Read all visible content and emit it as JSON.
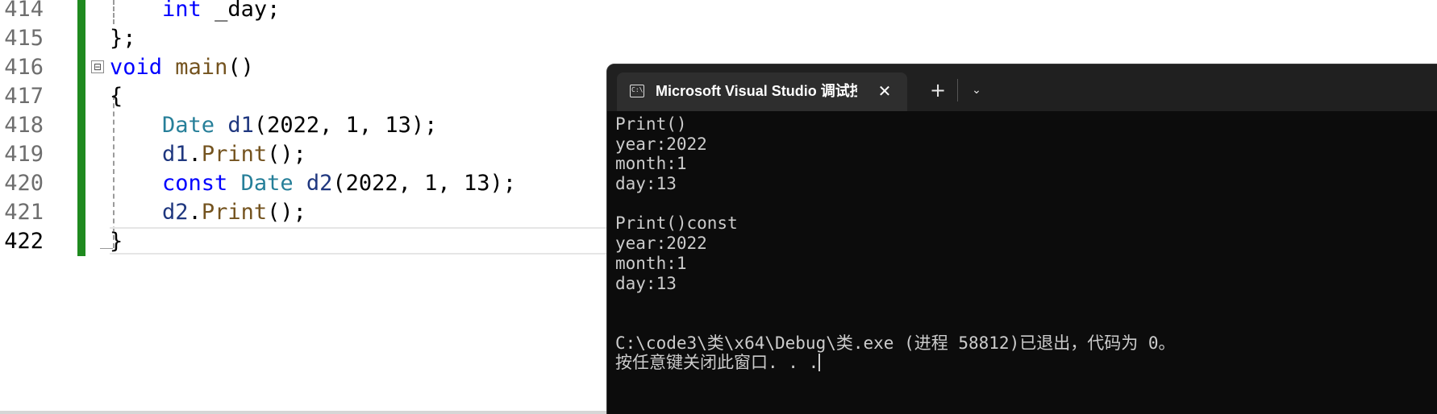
{
  "editor": {
    "lines": [
      {
        "number": "414",
        "tokens": [
          [
            "plain",
            "    "
          ],
          [
            "kw",
            "int"
          ],
          [
            "plain",
            " _day;"
          ]
        ]
      },
      {
        "number": "415",
        "tokens": [
          [
            "plain",
            "};"
          ]
        ]
      },
      {
        "number": "416",
        "tokens": [
          [
            "kw",
            "void"
          ],
          [
            "plain",
            " "
          ],
          [
            "fn",
            "main"
          ],
          [
            "plain",
            "()"
          ]
        ]
      },
      {
        "number": "417",
        "tokens": [
          [
            "plain",
            "{"
          ]
        ]
      },
      {
        "number": "418",
        "tokens": [
          [
            "plain",
            "    "
          ],
          [
            "ty2",
            "Date"
          ],
          [
            "plain",
            " "
          ],
          [
            "var",
            "d1"
          ],
          [
            "plain",
            "(2022, 1, 13);"
          ]
        ]
      },
      {
        "number": "419",
        "tokens": [
          [
            "plain",
            "    "
          ],
          [
            "var",
            "d1"
          ],
          [
            "plain",
            "."
          ],
          [
            "fn",
            "Print"
          ],
          [
            "plain",
            "();"
          ]
        ]
      },
      {
        "number": "420",
        "tokens": [
          [
            "plain",
            "    "
          ],
          [
            "kw",
            "const"
          ],
          [
            "plain",
            " "
          ],
          [
            "ty2",
            "Date"
          ],
          [
            "plain",
            " "
          ],
          [
            "var",
            "d2"
          ],
          [
            "plain",
            "(2022, 1, 13);"
          ]
        ]
      },
      {
        "number": "421",
        "tokens": [
          [
            "plain",
            "    "
          ],
          [
            "var",
            "d2"
          ],
          [
            "plain",
            "."
          ],
          [
            "fn",
            "Print"
          ],
          [
            "plain",
            "();"
          ]
        ]
      },
      {
        "number": "422",
        "tokens": [
          [
            "plain",
            "}"
          ]
        ],
        "current": true
      }
    ],
    "fold_symbol": "⊟"
  },
  "terminal": {
    "tab_title": "Microsoft Visual Studio 调试控制台",
    "tab_icon": "C:\\",
    "close_glyph": "✕",
    "new_tab_glyph": "+",
    "dropdown_glyph": "⌄",
    "output_lines": [
      "Print()",
      "year:2022",
      "month:1",
      "day:13",
      "",
      "Print()const",
      "year:2022",
      "month:1",
      "day:13",
      "",
      "",
      "C:\\code3\\类\\x64\\Debug\\类.exe (进程 58812)已退出，代码为 0。",
      "按任意键关闭此窗口. . ."
    ]
  }
}
